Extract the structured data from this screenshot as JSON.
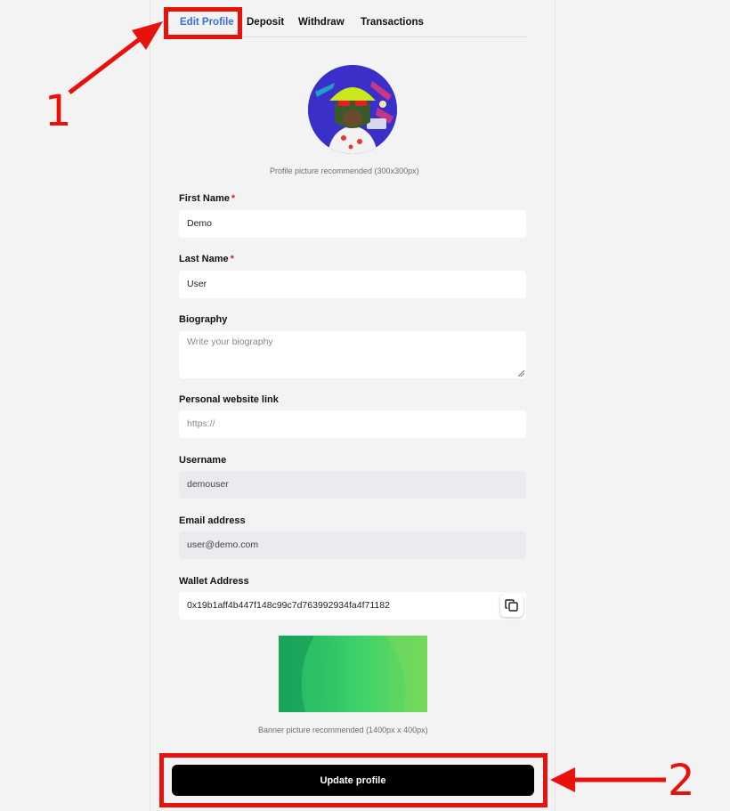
{
  "tabs": {
    "edit_profile": "Edit Profile",
    "deposit": "Deposit",
    "withdraw": "Withdraw",
    "transactions": "Transactions"
  },
  "avatar": {
    "hint": "Profile picture recommended (300x300px)"
  },
  "form": {
    "first_name": {
      "label": "First Name",
      "required": "*",
      "value": "Demo"
    },
    "last_name": {
      "label": "Last Name",
      "required": "*",
      "value": "User"
    },
    "biography": {
      "label": "Biography",
      "placeholder": "Write your biography"
    },
    "website": {
      "label": "Personal website link",
      "placeholder": "https://"
    },
    "username": {
      "label": "Username",
      "value": "demouser"
    },
    "email": {
      "label": "Email address",
      "value": "user@demo.com"
    },
    "wallet": {
      "label": "Wallet Address",
      "value": "0x19b1aff4b447f148c99c7d763992934fa4f71182"
    }
  },
  "banner": {
    "hint": "Banner picture recommended (1400px x 400px)"
  },
  "actions": {
    "update_label": "Update profile"
  },
  "annotations": {
    "marker_1": "1",
    "marker_2": "2",
    "highlight_color": "#e8120c"
  },
  "colors": {
    "active_tab": "#3a6fd8",
    "button_bg": "#000000",
    "required": "#dd2222"
  },
  "icons": {
    "copy": "copy-icon",
    "avatar_image": "avatar-image",
    "banner_image": "banner-image"
  }
}
